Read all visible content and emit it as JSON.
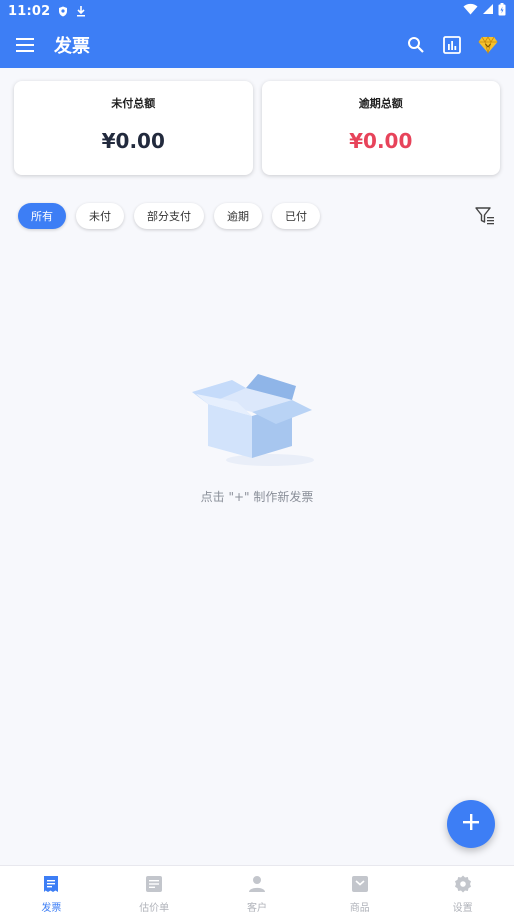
{
  "status_bar": {
    "time": "11:02"
  },
  "app_bar": {
    "title": "发票"
  },
  "summary": {
    "unpaid_label": "未付总额",
    "unpaid_value": "¥0.00",
    "overdue_label": "逾期总额",
    "overdue_value": "¥0.00"
  },
  "filters": {
    "chips": [
      "所有",
      "未付",
      "部分支付",
      "逾期",
      "已付"
    ],
    "selected": "所有"
  },
  "empty_state": {
    "message": "点击 \"+\" 制作新发票"
  },
  "bottom_nav": {
    "items": [
      {
        "label": "发票",
        "icon": "invoice-icon",
        "active": true
      },
      {
        "label": "估价单",
        "icon": "estimate-icon"
      },
      {
        "label": "客户",
        "icon": "person-icon"
      },
      {
        "label": "商品",
        "icon": "product-icon"
      },
      {
        "label": "设置",
        "icon": "gear-icon"
      }
    ]
  },
  "colors": {
    "accent": "#3d7ef5",
    "overdue": "#e7435a",
    "background": "#f7f8fc"
  }
}
